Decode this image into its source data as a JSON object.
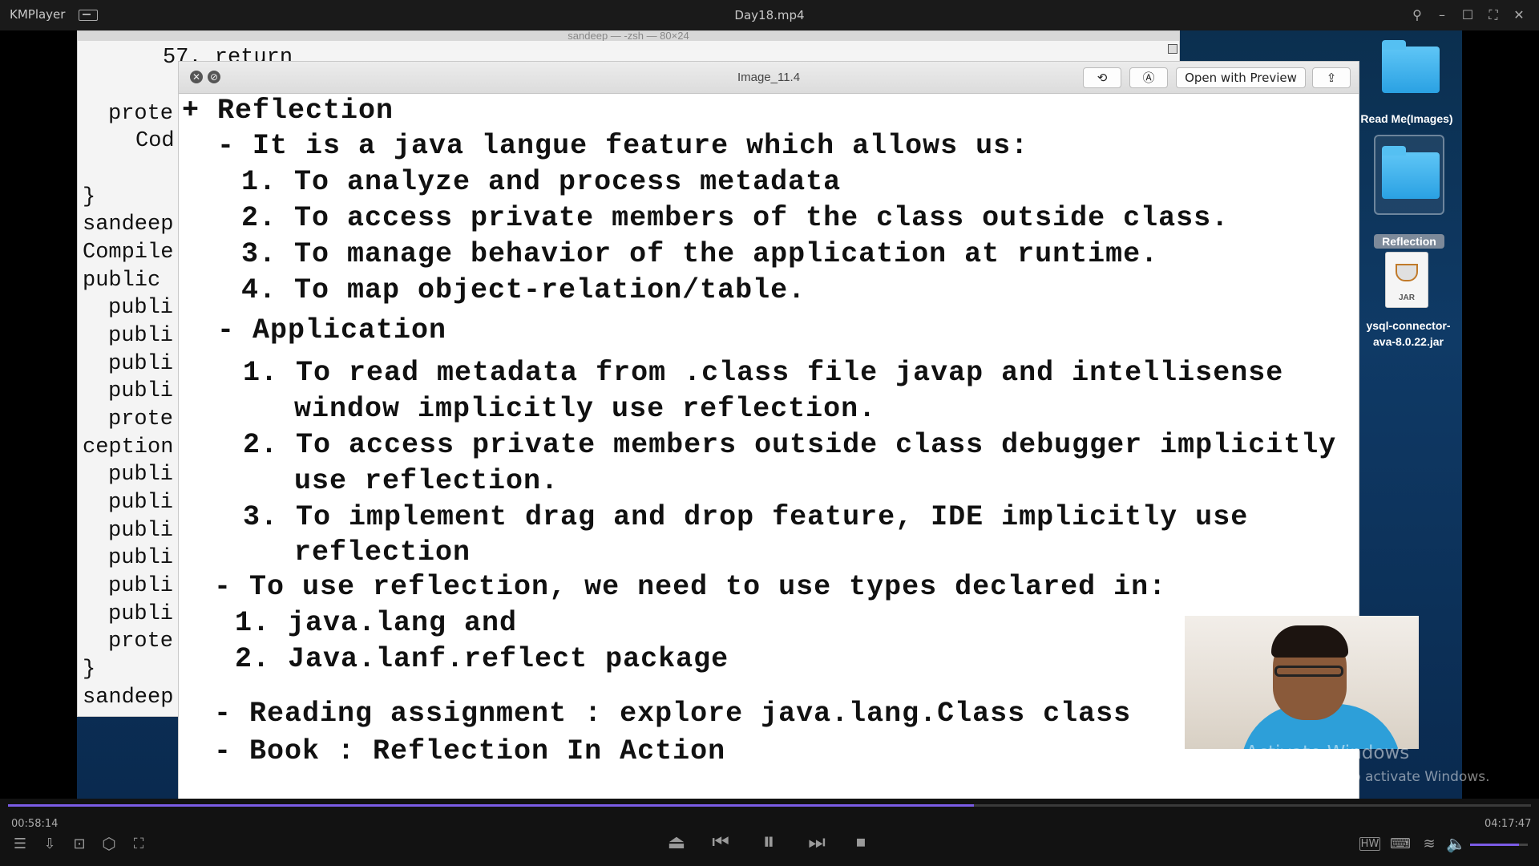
{
  "player": {
    "app_name": "KMPlayer",
    "file_title": "Day18.mp4",
    "elapsed": "00:58:14",
    "total": "04:17:47",
    "progress_fraction": 0.634,
    "volume_fraction": 0.85,
    "accent_color": "#7b5ce6"
  },
  "terminal": {
    "title": "sandeep — -zsh — 80×24",
    "lines": [
      "57. return",
      "prote",
      "Cod",
      "}",
      "sandeep",
      "Compile",
      "public",
      "publi",
      "publi",
      "publi",
      "publi",
      "prote",
      "ception",
      "publi",
      "publi",
      "publi",
      "publi",
      "publi",
      "publi",
      "prote",
      "}",
      "sandeep"
    ]
  },
  "preview": {
    "title": "Image_11.4",
    "open_with_preview": "Open with Preview",
    "close_glyph": "✕",
    "minimize_glyph": "⊘",
    "notes": [
      "+ Reflection",
      "- It is a java langue feature which allows us:",
      "1. To analyze and process metadata",
      "2. To access private members of the class outside class.",
      "3. To manage behavior of the application at runtime.",
      "4. To map object-relation/table.",
      "- Application",
      "1. To read metadata from .class file javap and intellisense",
      "window implicitly use reflection.",
      "2. To access private members outside class debugger implicitly",
      "use reflection.",
      "3. To implement drag and drop feature, IDE implicitly use",
      "reflection",
      "- To use reflection, we need to use types declared in:",
      "1. java.lang and",
      "2. Java.lanf.reflect package",
      "- Reading assignment : explore java.lang.Class class",
      "- Book : Reflection In Action"
    ]
  },
  "desktop": {
    "icons": [
      {
        "label": "Read Me(Images)",
        "type": "folder"
      },
      {
        "label": "Reflection",
        "type": "folder"
      },
      {
        "label_line1": "ysql-connector-",
        "label_line2": "ava-8.0.22.jar",
        "type": "jar",
        "badge": "JAR"
      }
    ]
  },
  "watermark": {
    "line1": "Activate Windows",
    "line2": "Go to Settings to activate Windows."
  }
}
